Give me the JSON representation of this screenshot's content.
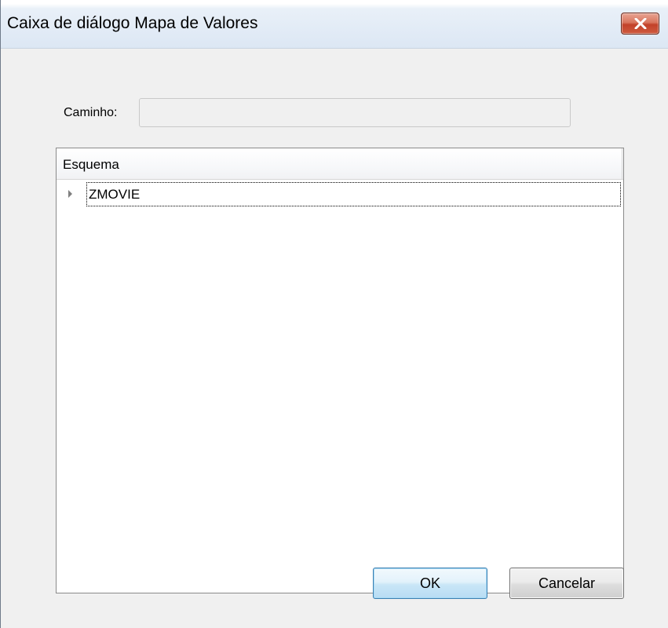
{
  "window": {
    "title": "Caixa de diálogo Mapa de Valores",
    "close_icon": "close-x-icon"
  },
  "path": {
    "label": "Caminho:",
    "value": ""
  },
  "tree": {
    "column_header": "Esquema",
    "items": [
      {
        "label": "ZMOVIE",
        "expanded": false,
        "expander_icon": "triangle-right-icon"
      }
    ]
  },
  "buttons": {
    "ok_label": "OK",
    "cancel_label": "Cancelar"
  },
  "colors": {
    "titlebar": "#dce7f4",
    "close_button": "#c2422a",
    "dialog_background": "#f0f0f0",
    "default_button": "#b7dcf3"
  }
}
